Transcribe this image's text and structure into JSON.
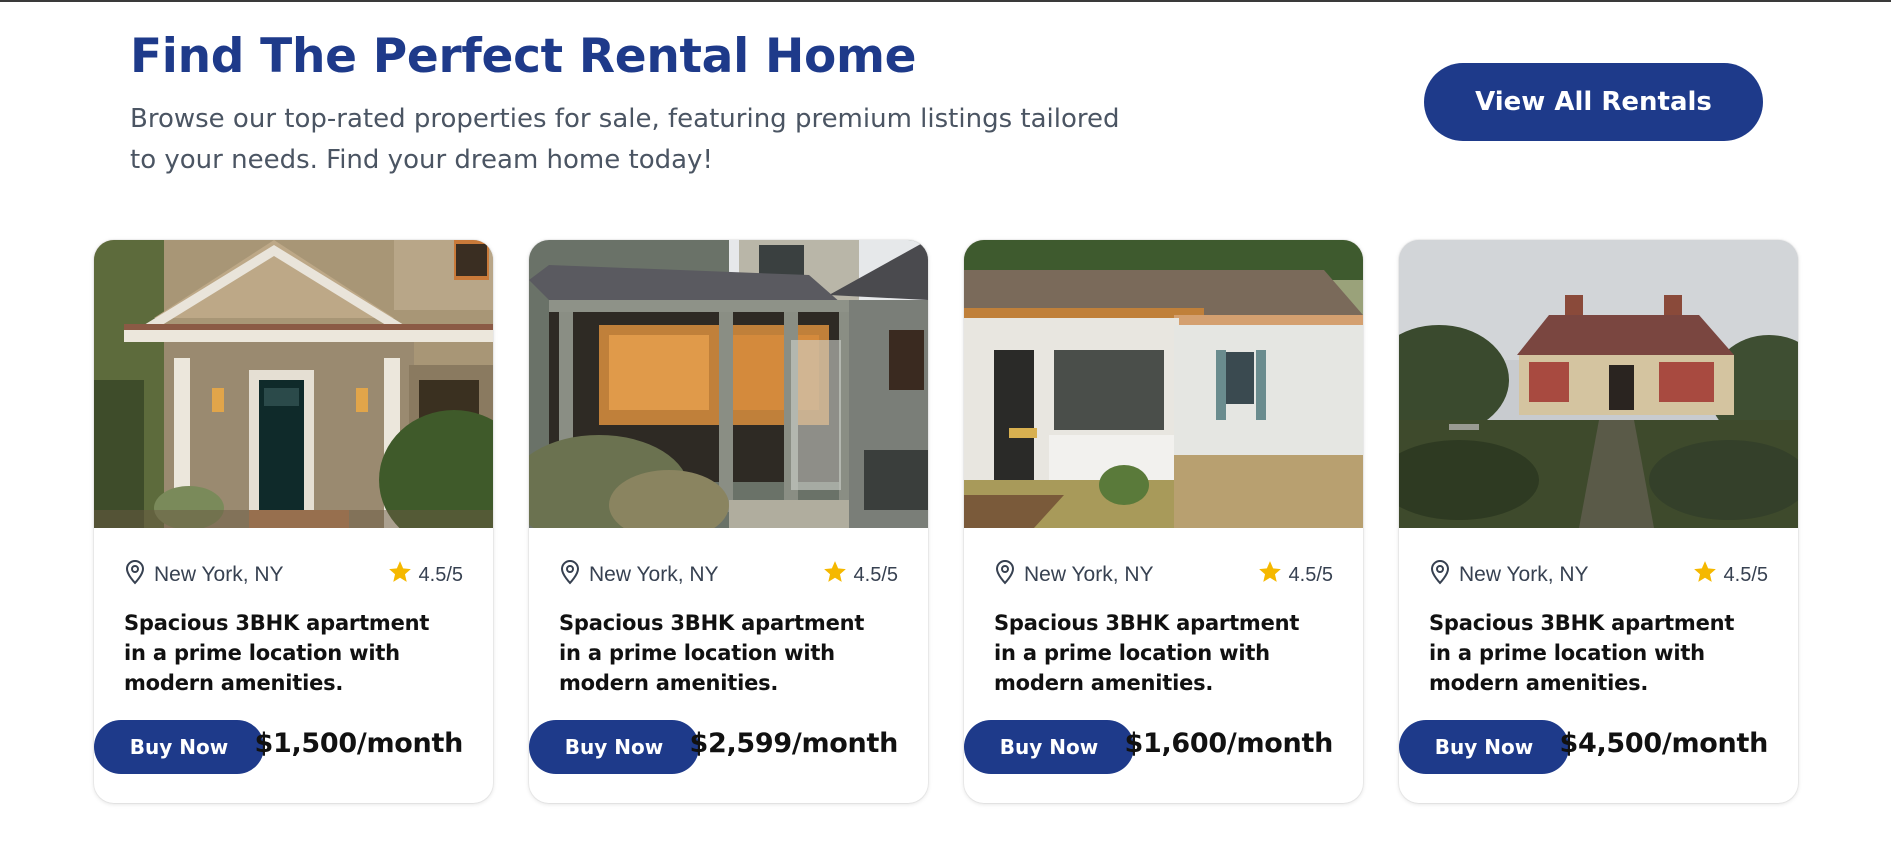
{
  "hero": {
    "title": "Find The Perfect Rental Home",
    "subtitle": "Browse our top-rated properties for sale, featuring premium listings tailored to your needs. Find your dream home today!"
  },
  "actions": {
    "view_all_label": "View All Rentals"
  },
  "colors": {
    "brand": "#1e3a8a",
    "star": "#f5b800",
    "muted_text": "#4b5563"
  },
  "listings": [
    {
      "location": "New York, NY",
      "rating": "4.5/5",
      "description": "Spacious 3BHK apartment in a prime location with modern amenities.",
      "button_label": "Buy Now",
      "price": "$1,500/month",
      "image": "tan-craftsman-house-front-porch"
    },
    {
      "location": "New York, NY",
      "rating": "4.5/5",
      "description": "Spacious 3BHK apartment in a prime location with modern amenities.",
      "button_label": "Buy Now",
      "price": "$2,599/month",
      "image": "screened-porch-string-lights"
    },
    {
      "location": "New York, NY",
      "rating": "4.5/5",
      "description": "Spacious 3BHK apartment in a prime location with modern amenities.",
      "button_label": "Buy Now",
      "price": "$1,600/month",
      "image": "white-cottage-screened-porch"
    },
    {
      "location": "New York, NY",
      "rating": "4.5/5",
      "description": "Spacious 3BHK apartment in a prime location with modern amenities.",
      "button_label": "Buy Now",
      "price": "$4,500/month",
      "image": "abandoned-brick-cottage"
    }
  ]
}
